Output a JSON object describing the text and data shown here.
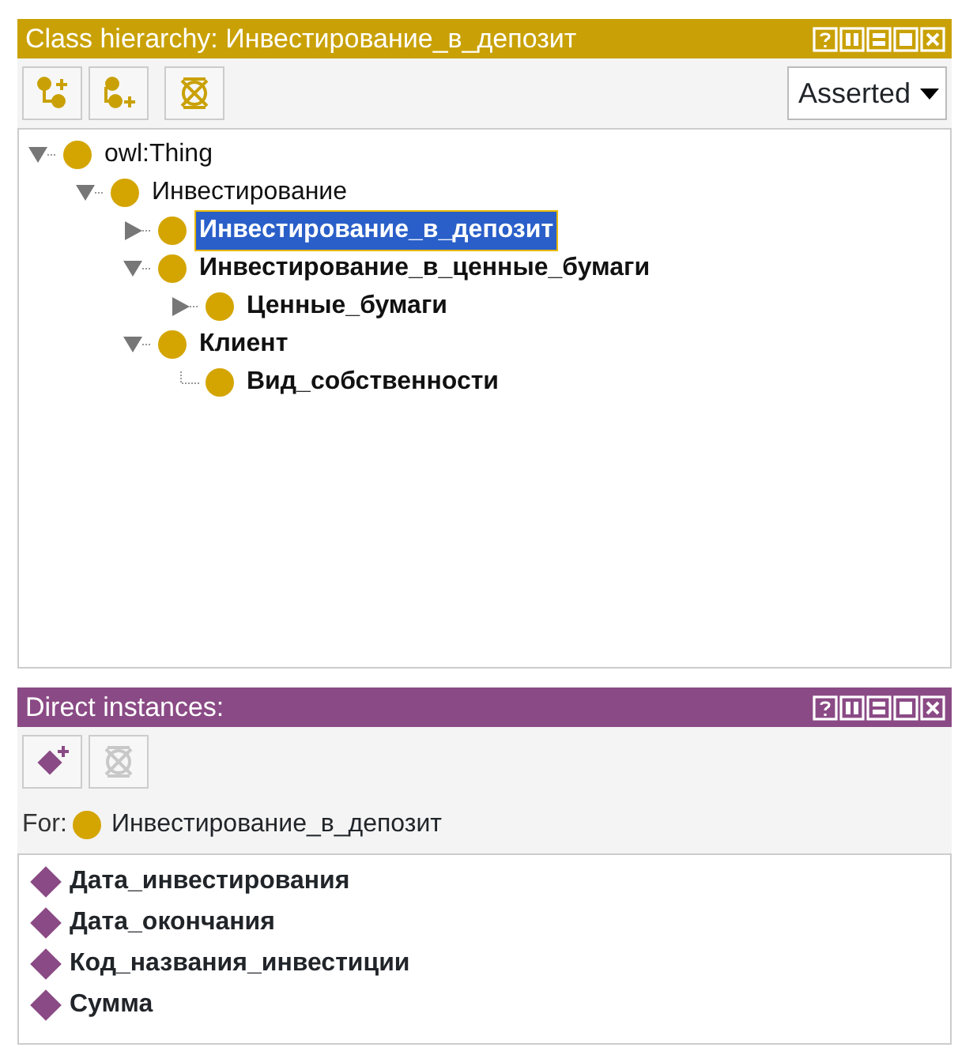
{
  "class_panel": {
    "title": "Class hierarchy: Инвестирование_в_депозит",
    "toolbar": [
      {
        "kind": "add-subclass",
        "disabled": false
      },
      {
        "kind": "add-sibling",
        "disabled": false
      },
      {
        "kind": "delete",
        "disabled": false
      }
    ],
    "view_select": {
      "value": "Asserted"
    },
    "tree": [
      {
        "label": "owl:Thing",
        "kind": "branch",
        "expanded": true,
        "bold": false,
        "selected": false,
        "children": [
          {
            "label": "Инвестирование",
            "kind": "branch",
            "expanded": true,
            "bold": false,
            "selected": false,
            "children": [
              {
                "label": "Инвестирование_в_депозит",
                "kind": "branch",
                "expanded": false,
                "bold": true,
                "selected": true
              },
              {
                "label": "Инвестирование_в_ценные_бумаги",
                "kind": "branch",
                "expanded": true,
                "bold": true,
                "selected": false,
                "children": [
                  {
                    "label": "Ценные_бумаги",
                    "kind": "branch",
                    "expanded": false,
                    "bold": true,
                    "selected": false
                  }
                ]
              },
              {
                "label": "Клиент",
                "kind": "branch",
                "expanded": true,
                "bold": true,
                "selected": false,
                "children": [
                  {
                    "label": "Вид_собственности",
                    "kind": "leaf",
                    "bold": true,
                    "selected": false
                  }
                ]
              }
            ]
          }
        ]
      }
    ]
  },
  "instances_panel": {
    "title": "Direct instances:",
    "toolbar": [
      {
        "kind": "add-individual",
        "disabled": false
      },
      {
        "kind": "delete",
        "disabled": true
      }
    ],
    "for_label": "For:",
    "for_class": "Инвестирование_в_депозит",
    "items": [
      {
        "label": "Дата_инвестирования"
      },
      {
        "label": "Дата_окончания"
      },
      {
        "label": "Код_названия_инвестиции"
      },
      {
        "label": "Сумма"
      }
    ]
  }
}
